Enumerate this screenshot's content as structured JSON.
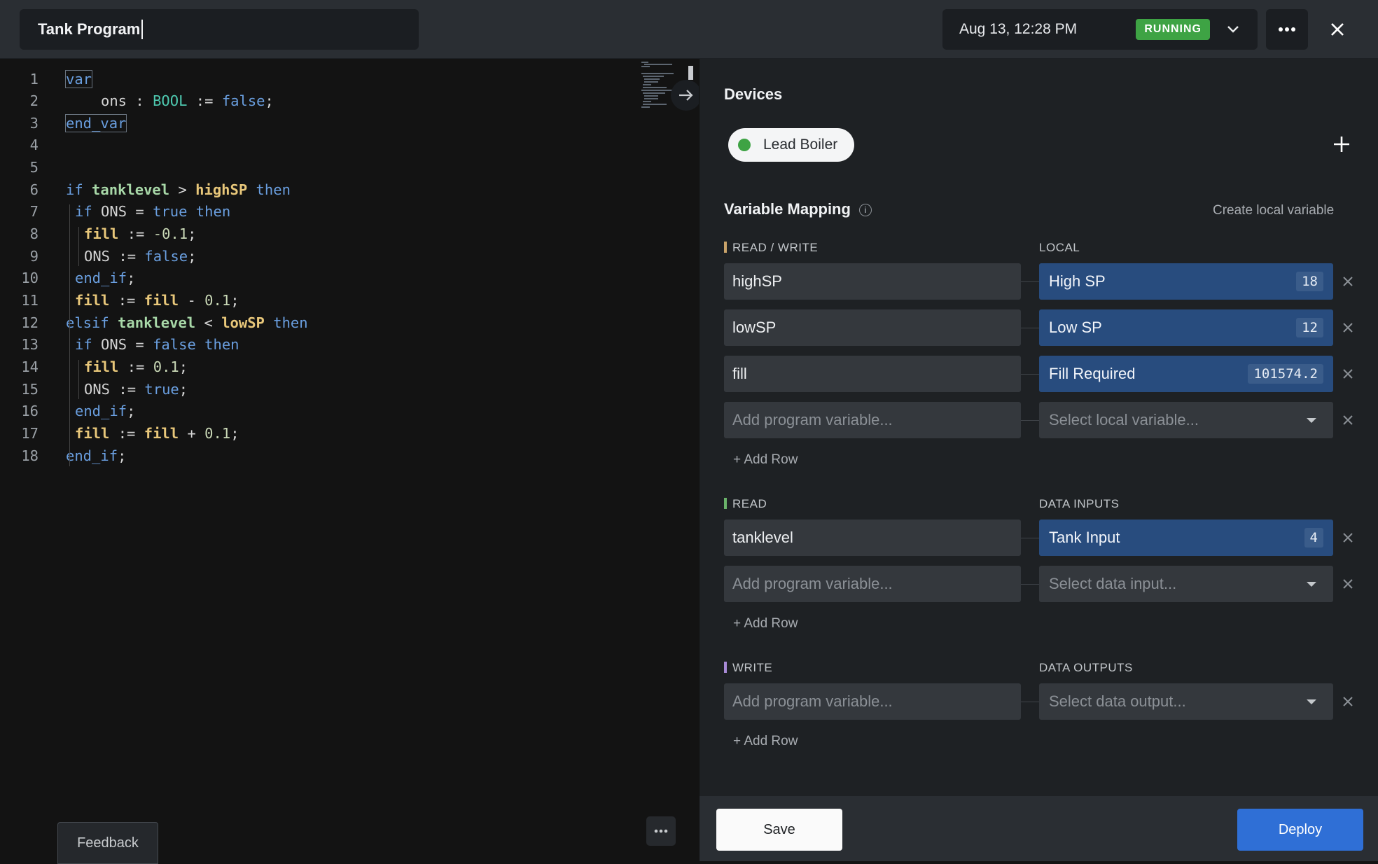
{
  "header": {
    "program_title": "Tank Program",
    "timestamp": "Aug 13, 12:28 PM",
    "status": "RUNNING",
    "status_color": "#3ea344"
  },
  "editor": {
    "lines": [
      {
        "n": "1"
      },
      {
        "n": "2"
      },
      {
        "n": "3"
      },
      {
        "n": "4"
      },
      {
        "n": "5"
      },
      {
        "n": "6"
      },
      {
        "n": "7"
      },
      {
        "n": "8"
      },
      {
        "n": "9"
      },
      {
        "n": "10"
      },
      {
        "n": "11"
      },
      {
        "n": "12"
      },
      {
        "n": "13"
      },
      {
        "n": "14"
      },
      {
        "n": "15"
      },
      {
        "n": "16"
      },
      {
        "n": "17"
      },
      {
        "n": "18"
      }
    ],
    "tokens": {
      "l1": [
        "var"
      ],
      "l2": [
        "ons",
        " : ",
        "BOOL",
        " := ",
        "false",
        ";"
      ],
      "l3": [
        "end_var"
      ],
      "l6": [
        "if ",
        "tanklevel",
        " > ",
        "highSP",
        " then"
      ],
      "l7": [
        "if ",
        "ONS",
        " = ",
        "true",
        " then"
      ],
      "l8": [
        "fill",
        " := ",
        "-0.1",
        ";"
      ],
      "l9": [
        "ONS",
        " := ",
        "false",
        ";"
      ],
      "l10": [
        "end_if",
        ";"
      ],
      "l11": [
        "fill",
        " := ",
        "fill",
        " - ",
        "0.1",
        ";"
      ],
      "l12": [
        "elsif ",
        "tanklevel",
        " < ",
        "lowSP",
        " then"
      ],
      "l13": [
        "if ",
        "ONS",
        " = ",
        "false",
        " then"
      ],
      "l14": [
        "fill",
        " := ",
        "0.1",
        ";"
      ],
      "l15": [
        "ONS",
        " := ",
        "true",
        ";"
      ],
      "l16": [
        "end_if",
        ";"
      ],
      "l17": [
        "fill",
        " := ",
        "fill",
        " + ",
        "0.1",
        ";"
      ],
      "l18": [
        "end_if",
        ";"
      ]
    },
    "feedback_label": "Feedback"
  },
  "panel": {
    "devices_title": "Devices",
    "device_name": "Lead Boiler",
    "device_status_color": "#3ea344",
    "mapping_title": "Variable Mapping",
    "create_local_label": "Create local variable",
    "read_write": {
      "label": "READ / WRITE",
      "target_label": "LOCAL",
      "accent": "#c9a36a",
      "rows": [
        {
          "program": "highSP",
          "local": "High SP",
          "value": "18"
        },
        {
          "program": "lowSP",
          "local": "Low SP",
          "value": "12"
        },
        {
          "program": "fill",
          "local": "Fill Required",
          "value": "101574.2"
        }
      ],
      "program_placeholder": "Add program variable...",
      "select_placeholder": "Select local variable...",
      "add_row": "+ Add Row"
    },
    "read": {
      "label": "READ",
      "target_label": "DATA INPUTS",
      "accent": "#6ab36a",
      "rows": [
        {
          "program": "tanklevel",
          "local": "Tank Input",
          "value": "4"
        }
      ],
      "program_placeholder": "Add program variable...",
      "select_placeholder": "Select data input...",
      "add_row": "+ Add Row"
    },
    "write": {
      "label": "WRITE",
      "target_label": "DATA OUTPUTS",
      "accent": "#a88ad6",
      "program_placeholder": "Add program variable...",
      "select_placeholder": "Select data output...",
      "add_row": "+ Add Row"
    },
    "save_label": "Save",
    "deploy_label": "Deploy"
  }
}
